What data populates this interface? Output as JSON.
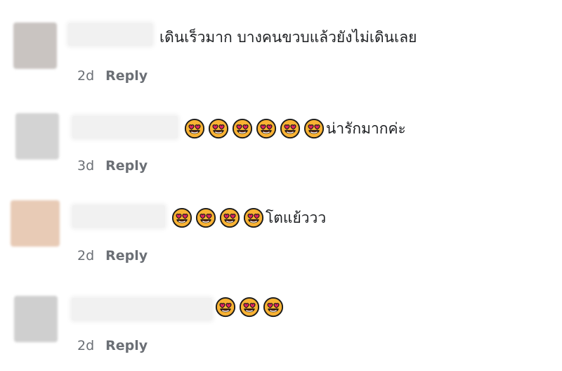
{
  "comments": [
    {
      "text": "เดินเร็วมาก บางคนขวบแล้วยังไม่เดินเลย",
      "emoji_count": 0,
      "emoji_icon": "heart-eyes-emoji-icon",
      "time": "2d",
      "reply": "Reply",
      "avatar_color": "#c9c4c1"
    },
    {
      "text": "น่ารักมากค่ะ",
      "emoji_count": 6,
      "emoji_icon": "heart-eyes-emoji-icon",
      "time": "3d",
      "reply": "Reply",
      "avatar_color": "#d3d3d3"
    },
    {
      "text": "โตแย้ววว",
      "emoji_count": 4,
      "emoji_icon": "heart-eyes-emoji-icon",
      "time": "2d",
      "reply": "Reply",
      "avatar_color": "#e8cbb6"
    },
    {
      "text": "",
      "emoji_count": 3,
      "emoji_icon": "heart-eyes-emoji-icon",
      "time": "2d",
      "reply": "Reply",
      "avatar_color": "#cfcfcf"
    }
  ]
}
